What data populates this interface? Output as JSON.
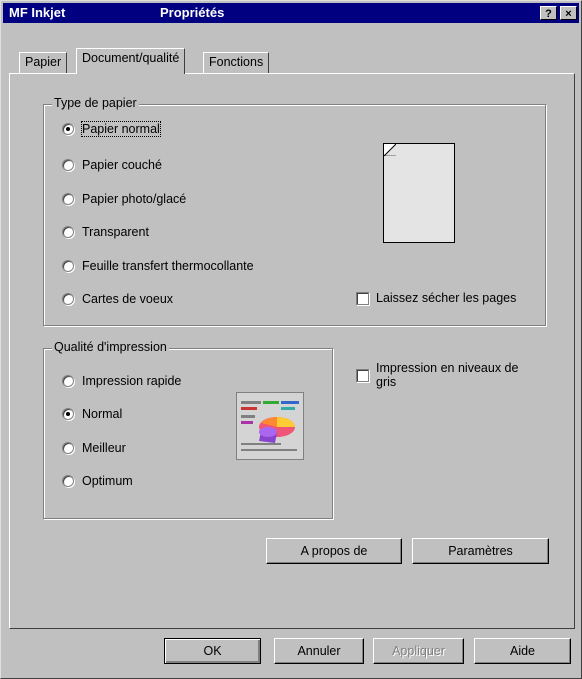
{
  "window": {
    "app_name": "MF Inkjet",
    "title": "Propriétés",
    "help_label": "?",
    "close_label": "×"
  },
  "tabs": [
    {
      "label": "Papier",
      "active": false
    },
    {
      "label": "Document/qualité",
      "active": true
    },
    {
      "label": "Fonctions",
      "active": false
    }
  ],
  "paper_type": {
    "legend": "Type de papier",
    "options": [
      {
        "label": "Papier normal",
        "selected": true
      },
      {
        "label": "Papier couché",
        "selected": false
      },
      {
        "label": "Papier photo/glacé",
        "selected": false
      },
      {
        "label": "Transparent",
        "selected": false
      },
      {
        "label": "Feuille transfert thermocollante",
        "selected": false
      },
      {
        "label": "Cartes de voeux",
        "selected": false
      }
    ],
    "dry_pages": {
      "label": "Laissez sécher les pages",
      "checked": false
    }
  },
  "print_quality": {
    "legend": "Qualité d'impression",
    "options": [
      {
        "label": "Impression rapide",
        "selected": false
      },
      {
        "label": "Normal",
        "selected": true
      },
      {
        "label": "Meilleur",
        "selected": false
      },
      {
        "label": "Optimum",
        "selected": false
      }
    ]
  },
  "grayscale": {
    "line1": "Impression en niveaux de",
    "line2": "gris",
    "checked": false
  },
  "buttons": {
    "about": "A propos de",
    "settings": "Paramètres",
    "ok": "OK",
    "cancel": "Annuler",
    "apply": "Appliquer",
    "help": "Aide"
  }
}
